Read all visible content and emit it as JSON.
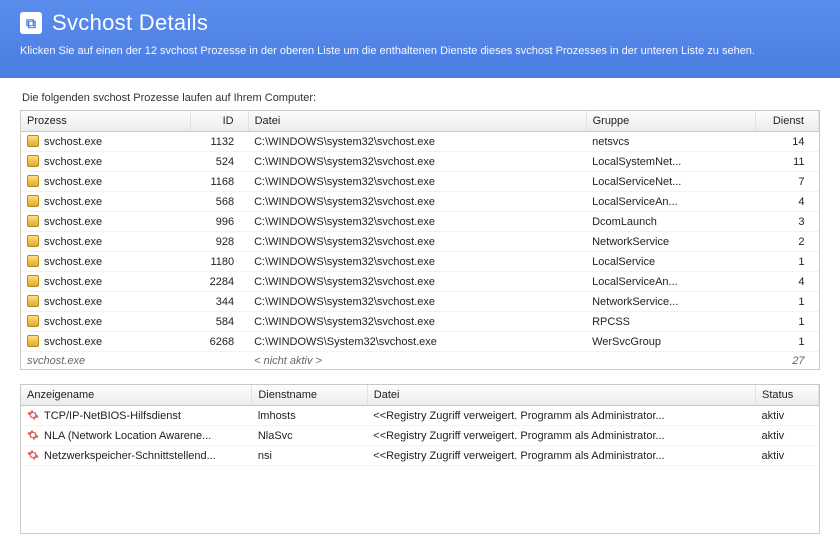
{
  "header": {
    "title": "Svchost Details",
    "description": "Klicken Sie auf einen der 12 svchost Prozesse in der oberen Liste um die enthaltenen Dienste dieses svchost Prozesses in der unteren Liste zu sehen."
  },
  "top": {
    "section_label": "Die folgenden svchost Prozesse laufen auf Ihrem Computer:",
    "columns": {
      "c0": "Prozess",
      "c1": "ID",
      "c2": "Datei",
      "c3": "Gruppe",
      "c4": "Dienst"
    },
    "rows": [
      {
        "proc": "svchost.exe",
        "id": "1132",
        "file": "C:\\WINDOWS\\system32\\svchost.exe",
        "group": "netsvcs",
        "svc": "14"
      },
      {
        "proc": "svchost.exe",
        "id": "524",
        "file": "C:\\WINDOWS\\system32\\svchost.exe",
        "group": "LocalSystemNet...",
        "svc": "11"
      },
      {
        "proc": "svchost.exe",
        "id": "1168",
        "file": "C:\\WINDOWS\\system32\\svchost.exe",
        "group": "LocalServiceNet...",
        "svc": "7"
      },
      {
        "proc": "svchost.exe",
        "id": "568",
        "file": "C:\\WINDOWS\\system32\\svchost.exe",
        "group": "LocalServiceAn...",
        "svc": "4"
      },
      {
        "proc": "svchost.exe",
        "id": "996",
        "file": "C:\\WINDOWS\\system32\\svchost.exe",
        "group": "DcomLaunch",
        "svc": "3"
      },
      {
        "proc": "svchost.exe",
        "id": "928",
        "file": "C:\\WINDOWS\\system32\\svchost.exe",
        "group": "NetworkService",
        "svc": "2"
      },
      {
        "proc": "svchost.exe",
        "id": "1180",
        "file": "C:\\WINDOWS\\system32\\svchost.exe",
        "group": "LocalService",
        "svc": "1"
      },
      {
        "proc": "svchost.exe",
        "id": "2284",
        "file": "C:\\WINDOWS\\system32\\svchost.exe",
        "group": "LocalServiceAn...",
        "svc": "4"
      },
      {
        "proc": "svchost.exe",
        "id": "344",
        "file": "C:\\WINDOWS\\system32\\svchost.exe",
        "group": "NetworkService...",
        "svc": "1"
      },
      {
        "proc": "svchost.exe",
        "id": "584",
        "file": "C:\\WINDOWS\\system32\\svchost.exe",
        "group": "RPCSS",
        "svc": "1"
      },
      {
        "proc": "svchost.exe",
        "id": "6268",
        "file": "C:\\WINDOWS\\System32\\svchost.exe",
        "group": "WerSvcGroup",
        "svc": "1"
      }
    ],
    "footer": {
      "proc": "svchost.exe",
      "file": "< nicht aktiv >",
      "svc": "27"
    }
  },
  "bottom": {
    "columns": {
      "c0": "Anzeigename",
      "c1": "Dienstname",
      "c2": "Datei",
      "c3": "Status"
    },
    "rows": [
      {
        "name": "TCP/IP-NetBIOS-Hilfsdienst",
        "svc": "lmhosts",
        "file": "<<Registry Zugriff verweigert. Programm als Administrator...",
        "status": "aktiv"
      },
      {
        "name": "NLA (Network Location Awarene...",
        "svc": "NlaSvc",
        "file": "<<Registry Zugriff verweigert. Programm als Administrator...",
        "status": "aktiv"
      },
      {
        "name": "Netzwerkspeicher-Schnittstellend...",
        "svc": "nsi",
        "file": "<<Registry Zugriff verweigert. Programm als Administrator...",
        "status": "aktiv"
      }
    ]
  }
}
